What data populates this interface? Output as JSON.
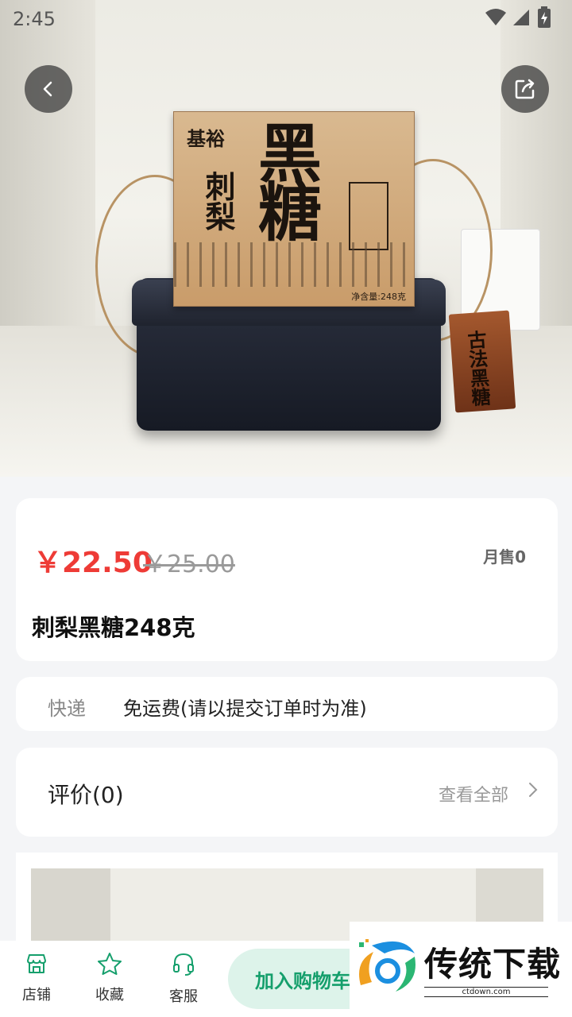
{
  "status_bar": {
    "time": "2:45"
  },
  "hero": {
    "product_image": {
      "brand": "基裕",
      "name_big": "黑糖",
      "name_small": "刺梨",
      "net_weight": "净含量:248克",
      "tag_text": "古法黑糖"
    }
  },
  "product": {
    "price": "￥22.50",
    "original_price": "￥25.00",
    "monthly_sales": "月售0",
    "title": "刺梨黑糖248克"
  },
  "shipping": {
    "label": "快递",
    "value": "免运费(请以提交订单时为准)"
  },
  "reviews": {
    "title": "评价(0)",
    "view_all": "查看全部"
  },
  "bottom_bar": {
    "store": "店铺",
    "favorite": "收藏",
    "service": "客服",
    "add_to_cart": "加入购物车"
  },
  "watermark": {
    "text": "传统下载",
    "url": "ctdown.com"
  },
  "colors": {
    "price_red": "#ee3b36",
    "accent_green": "#159f6c",
    "cart_bg": "#ddf3ea"
  }
}
